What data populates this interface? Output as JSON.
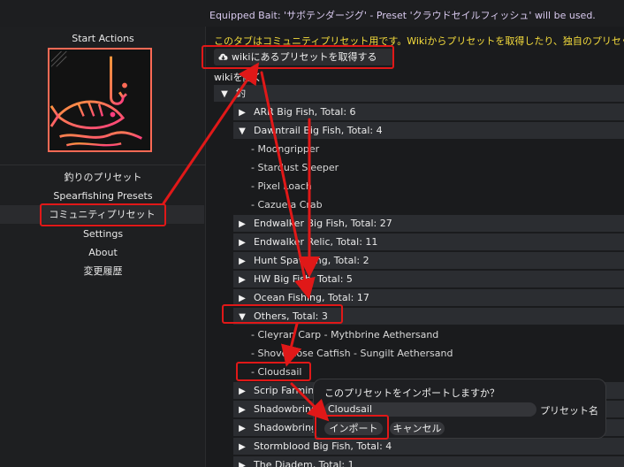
{
  "header": {
    "bait_status": "Equipped Bait: 'サボテンダージグ' - Preset 'クラウドセイルフィッシュ' will be used."
  },
  "sidebar": {
    "title": "Start Actions",
    "nav": [
      {
        "label": "釣りのプリセット",
        "active": false
      },
      {
        "label": "Spearfishing Presets",
        "active": false
      },
      {
        "label": "コミュニティプリセット",
        "active": true
      },
      {
        "label": "Settings",
        "active": false
      },
      {
        "label": "About",
        "active": false
      },
      {
        "label": "変更履歴",
        "active": false
      }
    ]
  },
  "main": {
    "notice": "このタブはコミュニティプリセット用です。Wikiからプリセットを取得したり、独自のプリセッ",
    "fetch_button": "wikiにあるプリセットを取得する",
    "open_wiki": "wikiを開く",
    "root_label": "釣",
    "groups": [
      {
        "label": "ARR Big Fish, Total: 6",
        "expanded": false
      },
      {
        "label": "Dawntrail Big Fish, Total: 4",
        "expanded": true,
        "items": [
          "- Moongripper",
          "- Stardust Sleeper",
          "- Pixel Loach",
          "- Cazuela Crab"
        ]
      },
      {
        "label": "Endwalker Big Fish, Total: 27",
        "expanded": false
      },
      {
        "label": "Endwalker Relic, Total: 11",
        "expanded": false
      },
      {
        "label": "Hunt Spawning, Total: 2",
        "expanded": false
      },
      {
        "label": "HW Big Fish, Total: 5",
        "expanded": false
      },
      {
        "label": "Ocean Fishing, Total: 17",
        "expanded": false
      },
      {
        "label": "Others, Total: 3",
        "expanded": true,
        "items": [
          "- Cleyran Carp - Mythbrine Aethersand",
          "- Shovelnose Catfish - Sungilt Aethersand",
          "- Cloudsail"
        ]
      },
      {
        "label": "Scrip Farming",
        "expanded": false
      },
      {
        "label": "Shadowbringers",
        "expanded": false
      },
      {
        "label": "Shadowbringers",
        "expanded": false
      },
      {
        "label": "Stormblood Big Fish, Total: 4",
        "expanded": false
      },
      {
        "label": "The Diadem, Total: 1",
        "expanded": false
      }
    ]
  },
  "popup": {
    "title": "このプリセットをインポートしますか？",
    "name_value": "Cloudsail",
    "name_label": "プリセット名",
    "import_button": "インポート",
    "cancel_button": "キャンセル"
  },
  "colors": {
    "notice": "#f5dc3c",
    "annotation": "#e01818",
    "logo_accent": "#ff6a55"
  }
}
